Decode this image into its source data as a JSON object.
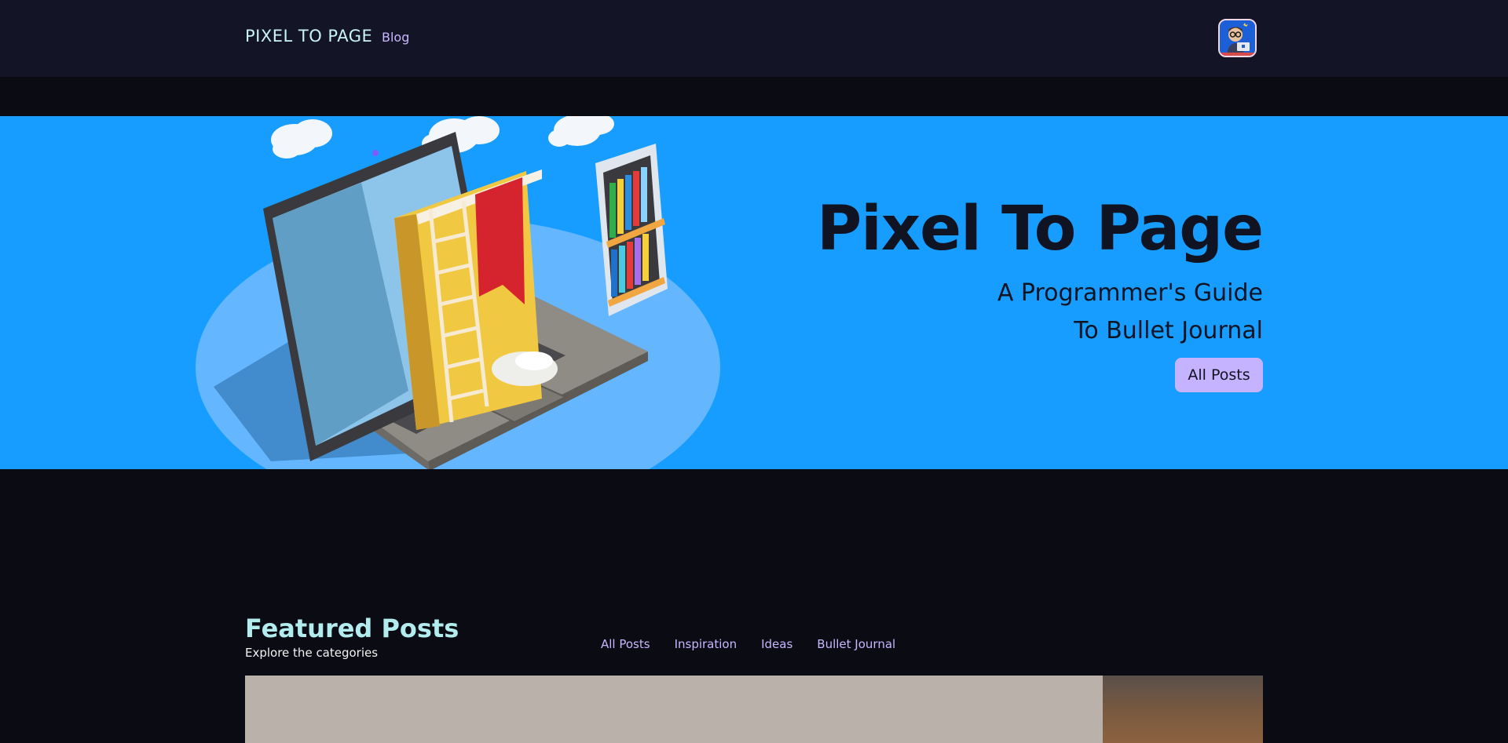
{
  "navbar": {
    "brand": "PIXEL TO PAGE",
    "link_blog": "Blog",
    "avatar_icon": "developer-avatar-icon"
  },
  "hero": {
    "title": "Pixel To Page",
    "subtitle_line1": "A Programmer's Guide",
    "subtitle_line2": "To Bullet Journal",
    "cta": "All Posts",
    "background_color": "#179dff",
    "illustration": "laptop-books-phone-illustration"
  },
  "featured": {
    "title": "Featured Posts",
    "subtitle": "Explore the categories",
    "tabs": [
      "All Posts",
      "Inspiration",
      "Ideas",
      "Bullet Journal"
    ]
  },
  "colors": {
    "accent_lavender": "#c6b3ff",
    "accent_cyan": "#b3ecee",
    "nav_bg": "#131526",
    "page_bg": "#0b0b14"
  }
}
